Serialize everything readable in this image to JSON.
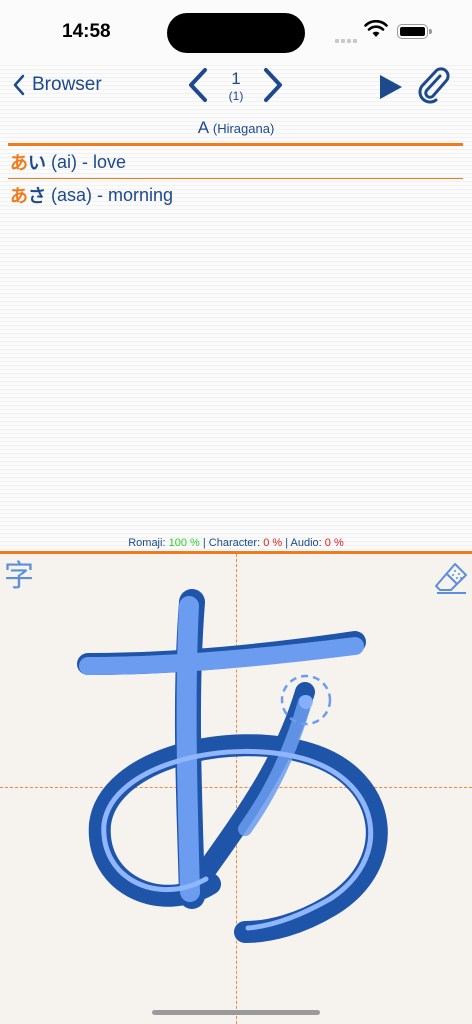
{
  "status": {
    "time": "14:58",
    "wifi_icon": "wifi-icon",
    "battery_icon": "battery-icon"
  },
  "nav": {
    "back_label": "Browser",
    "page_current": "1",
    "page_total": "(1)"
  },
  "character": {
    "title": "A",
    "subtitle": "(Hiragana)"
  },
  "words": [
    {
      "kana_main": "あ",
      "kana_rest": "い",
      "romaji": " (ai) - love"
    },
    {
      "kana_main": "あ",
      "kana_rest": "さ",
      "romaji": " (asa) - morning"
    }
  ],
  "stats": {
    "romaji_label": "Romaji:",
    "romaji_value": "100 %",
    "sep1": " | ",
    "character_label": "Character:",
    "character_value": "0 %",
    "sep2": " | ",
    "audio_label": "Audio:",
    "audio_value": "0 %"
  },
  "canvas": {
    "kanji_toggle": "字"
  },
  "colors": {
    "accent": "#f07a1e",
    "primary": "#1c4a8c",
    "stroke": "#5b8fd8",
    "good": "#2dd12d",
    "bad": "#e02020"
  }
}
